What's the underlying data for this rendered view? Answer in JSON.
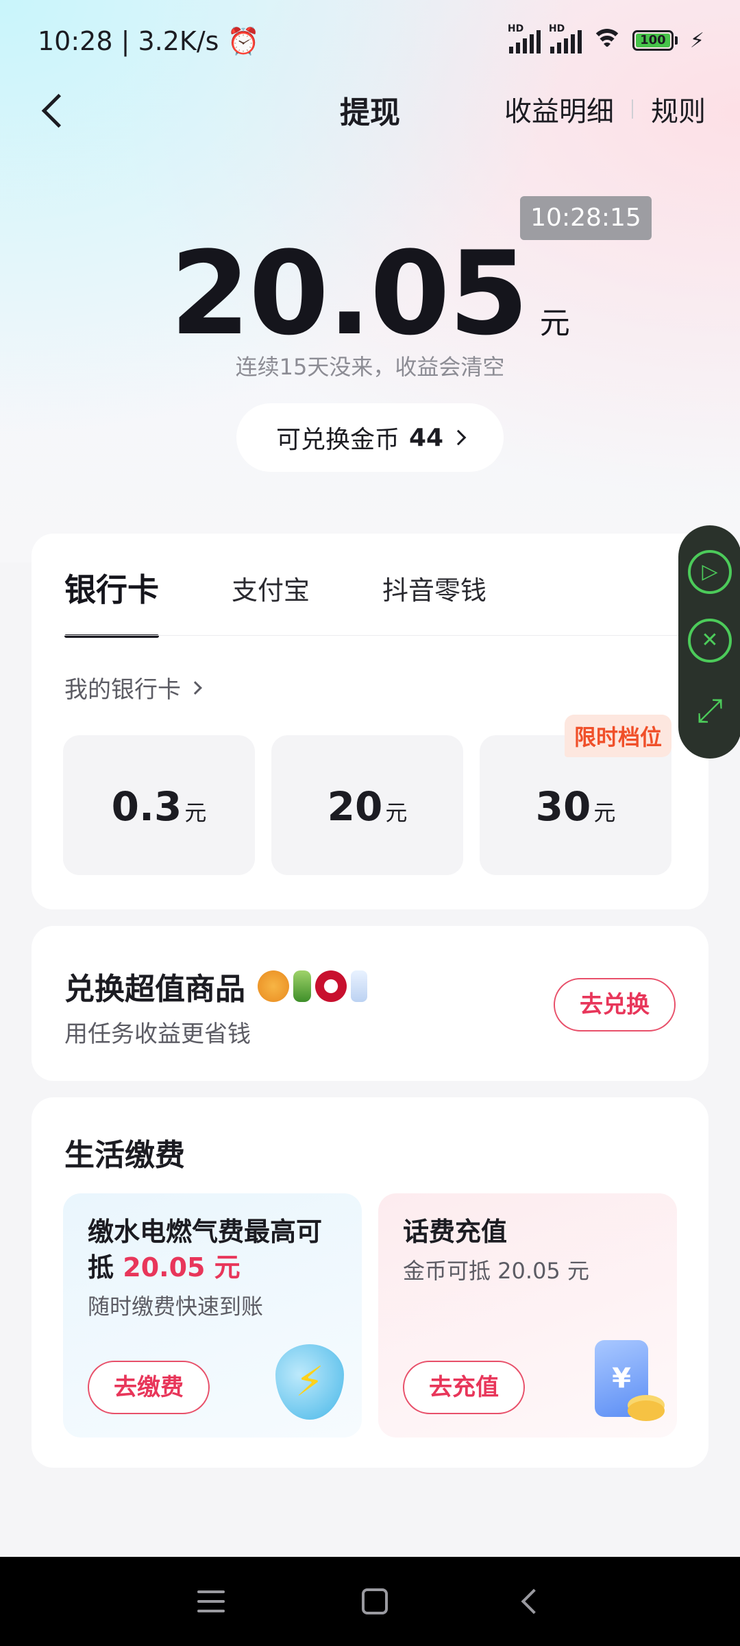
{
  "status_bar": {
    "time_speed": "10:28 | 3.2K/s",
    "alarm_icon": "⏰",
    "signal1_hd": "HD",
    "signal2_hd": "HD",
    "battery": "100",
    "charging_icon": "⚡"
  },
  "header": {
    "title": "提现",
    "earnings_detail": "收益明细",
    "rules": "规则"
  },
  "balance": {
    "timestamp": "10:28:15",
    "amount": "20.05",
    "unit": "元",
    "note": "连续15天没来，收益会清空",
    "coins_label": "可兑换金币",
    "coins_value": "44"
  },
  "withdraw": {
    "tabs": [
      {
        "label": "银行卡",
        "active": true
      },
      {
        "label": "支付宝",
        "active": false
      },
      {
        "label": "抖音零钱",
        "active": false
      }
    ],
    "my_bank_card": "我的银行卡",
    "amount_options": [
      {
        "value": "0.3",
        "unit": "元",
        "badge": ""
      },
      {
        "value": "20",
        "unit": "元",
        "badge": ""
      },
      {
        "value": "30",
        "unit": "元",
        "badge": "限时档位"
      }
    ]
  },
  "exchange": {
    "title": "兑换超值商品",
    "subtitle": "用任务收益更省钱",
    "button": "去兑换"
  },
  "life": {
    "title": "生活缴费",
    "utility": {
      "title_prefix": "缴水电燃气费最高可抵",
      "title_amount": "20.05 元",
      "desc": "随时缴费快速到账",
      "button": "去缴费"
    },
    "phone": {
      "title": "话费充值",
      "desc": "金币可抵 20.05 元",
      "button": "去充值",
      "icon_symbol": "¥"
    }
  },
  "floating_widget": {
    "play_icon": "▷",
    "close_icon": "✕",
    "expand_icon": "⤢"
  },
  "colors": {
    "accent_red": "#e8365a",
    "badge_orange": "#f0502a",
    "widget_green": "#4ccb5a"
  }
}
